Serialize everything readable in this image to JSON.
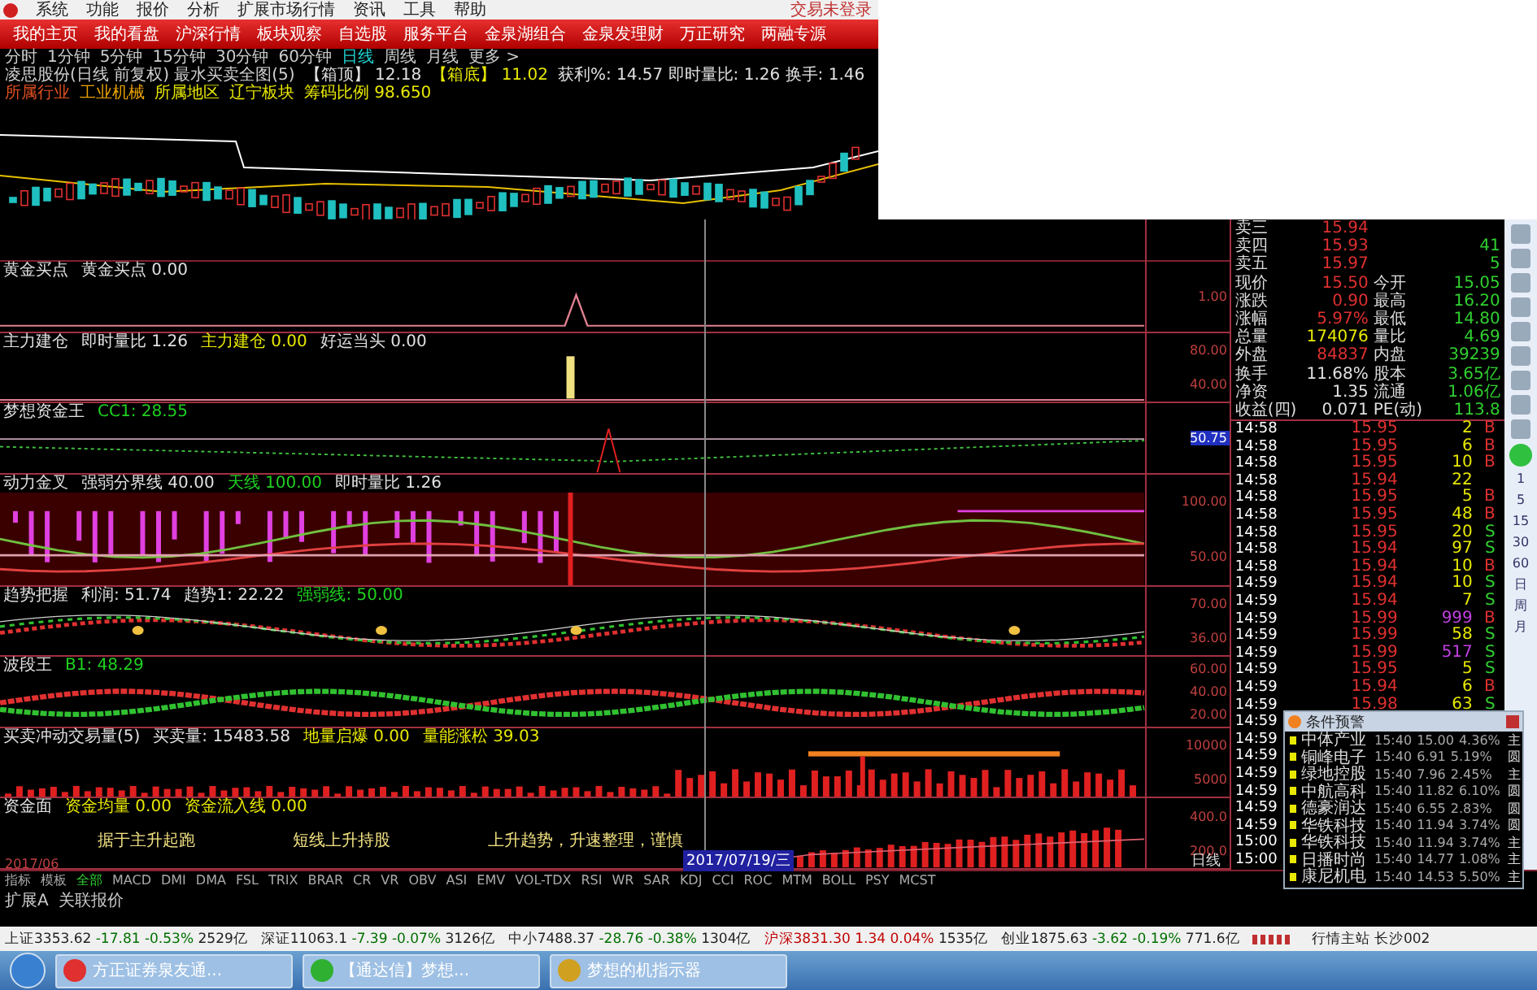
{
  "menu_bar": {
    "items": [
      "系统",
      "功能",
      "报价",
      "分析",
      "扩展市场行情",
      "资讯",
      "工具",
      "帮助"
    ],
    "login_status": "交易未登录"
  },
  "nav_bar": {
    "items": [
      "我的主页",
      "我的看盘",
      "沪深行情",
      "板块观察",
      "自选股",
      "服务平台",
      "金泉湖组合",
      "金泉发理财",
      "万正研究",
      "两融专源"
    ]
  },
  "periods": [
    {
      "label": "分时",
      "selected": false
    },
    {
      "label": "1分钟",
      "selected": false
    },
    {
      "label": "5分钟",
      "selected": false
    },
    {
      "label": "15分钟",
      "selected": false
    },
    {
      "label": "30分钟",
      "selected": false
    },
    {
      "label": "60分钟",
      "selected": false
    },
    {
      "label": "日线",
      "selected": true
    },
    {
      "label": "周线",
      "selected": false
    },
    {
      "label": "月线",
      "selected": false
    },
    {
      "label": "更多 >",
      "selected": false
    }
  ],
  "info_line": [
    {
      "text": "凌思股份(日线 前复权) 最水买卖全图(5)",
      "color": "#d0d0d0"
    },
    {
      "text": "【箱顶】 12.18",
      "color": "#e0e0e0"
    },
    {
      "text": "【箱底】 11.02",
      "color": "#e8e800"
    },
    {
      "text": "获利%: 14.57  即时量比: 1.26  换手: 1.46",
      "color": "#e0e0e0"
    }
  ],
  "info_line_2": [
    {
      "text": "所属行业",
      "color": "#e05020"
    },
    {
      "text": "工业机械",
      "color": "#e8a000"
    },
    {
      "text": "所属地区",
      "color": "#e8e800"
    },
    {
      "text": "辽宁板块",
      "color": "#e8e800"
    },
    {
      "text": "筹码比例 98.650",
      "color": "#e8e800"
    }
  ],
  "panels": [
    {
      "kind": "spike",
      "title": [
        {
          "text": "黄金买点",
          "color": "#e0e0e0"
        },
        {
          "text": "黄金买点 0.00",
          "color": "#e0e0e0"
        }
      ],
      "axis": [
        {
          "text": "1.00",
          "highlighted": false
        }
      ]
    },
    {
      "kind": "bar-spike",
      "title": [
        {
          "text": "主力建仓",
          "color": "#e0e0e0"
        },
        {
          "text": "即时量比 1.26",
          "color": "#e0e0e0"
        },
        {
          "text": "主力建仓 0.00",
          "color": "#e8e800"
        },
        {
          "text": "好运当头 0.00",
          "color": "#e0e0e0"
        }
      ],
      "axis": [
        {
          "text": "80.00",
          "highlighted": false
        },
        {
          "text": "40.00",
          "highlighted": false
        }
      ]
    },
    {
      "kind": "curve",
      "title": [
        {
          "text": "梦想资金王",
          "color": "#e0e0e0"
        },
        {
          "text": "CC1: 28.55",
          "color": "#20d020"
        }
      ],
      "axis": [
        {
          "text": "50.75",
          "highlighted": true
        }
      ]
    },
    {
      "kind": "histogram",
      "title": [
        {
          "text": "动力金叉",
          "color": "#e0e0e0"
        },
        {
          "text": "强弱分界线 40.00",
          "color": "#e0e0e0"
        },
        {
          "text": "天线 100.00",
          "color": "#20d020"
        },
        {
          "text": "即时量比 1.26",
          "color": "#e0e0e0"
        }
      ],
      "axis": [
        {
          "text": "100.00",
          "highlighted": false
        },
        {
          "text": "50.00",
          "highlighted": false
        }
      ]
    },
    {
      "kind": "ribbon",
      "title": [
        {
          "text": "趋势把握",
          "color": "#e0e0e0"
        },
        {
          "text": "利润: 51.74",
          "color": "#e0e0e0"
        },
        {
          "text": "趋势1: 22.22",
          "color": "#e0e0e0"
        },
        {
          "text": "强弱线: 50.00",
          "color": "#20d020"
        }
      ],
      "axis": [
        {
          "text": "70.00",
          "highlighted": false
        },
        {
          "text": "36.00",
          "highlighted": false
        }
      ]
    },
    {
      "kind": "wave",
      "title": [
        {
          "text": "波段王",
          "color": "#e0e0e0"
        },
        {
          "text": "B1: 48.29",
          "color": "#20d020"
        }
      ],
      "axis": [
        {
          "text": "60.00",
          "highlighted": false
        },
        {
          "text": "40.00",
          "highlighted": false
        },
        {
          "text": "20.00",
          "highlighted": false
        }
      ]
    },
    {
      "kind": "volume",
      "title": [
        {
          "text": "买卖冲动交易量(5)",
          "color": "#e0e0e0"
        },
        {
          "text": "买卖量: 15483.58",
          "color": "#e0e0e0"
        },
        {
          "text": "地量启爆 0.00",
          "color": "#e8e800"
        },
        {
          "text": "量能涨松 39.03",
          "color": "#e8e800"
        }
      ],
      "axis": [
        {
          "text": "10000",
          "highlighted": false
        },
        {
          "text": "5000",
          "highlighted": false
        }
      ]
    },
    {
      "kind": "area",
      "title": [
        {
          "text": "资金面",
          "color": "#e0e0e0"
        },
        {
          "text": "资金均量 0.00",
          "color": "#e8e800"
        },
        {
          "text": "资金流入线 0.00",
          "color": "#e8e800"
        }
      ],
      "axis": [
        {
          "text": "400.0",
          "highlighted": false
        },
        {
          "text": "200.0",
          "highlighted": false
        }
      ],
      "notes": [
        "据于主升起跑",
        "短线上升持股",
        "上升趋势，升速整理，谨慎"
      ]
    }
  ],
  "date_axis": {
    "start": "2017/06",
    "cursor": "2017/07/19/三",
    "period": "日线"
  },
  "quote": [
    {
      "label": "卖三",
      "value": "15.94",
      "color": "#e03030"
    },
    {
      "label": "卖四",
      "value": "15.93",
      "color": "#e03030",
      "value_2": "41"
    },
    {
      "label": "卖五",
      "value": "15.97",
      "color": "#e03030",
      "value_2": "5"
    },
    {
      "label": "现价",
      "value": "15.50",
      "color": "#e03030",
      "label_2": "今开",
      "value_2": "15.05"
    },
    {
      "label": "涨跌",
      "value": "0.90",
      "color": "#e03030",
      "label_2": "最高",
      "value_2": "16.20"
    },
    {
      "label": "涨幅",
      "value": "5.97%",
      "color": "#e03030",
      "label_2": "最低",
      "value_2": "14.80"
    },
    {
      "label": "总量",
      "value": "174076",
      "color": "#e8e800",
      "label_2": "量比",
      "value_2": "4.69"
    },
    {
      "label": "外盘",
      "value": "84837",
      "color": "#e03030",
      "label_2": "内盘",
      "value_2": "39239"
    },
    {
      "label": "换手",
      "value": "11.68%",
      "color": "#e0e0e0",
      "label_2": "股本",
      "value_2": "3.65亿"
    },
    {
      "label": "净资",
      "value": "1.35",
      "color": "#e0e0e0",
      "label_2": "流通",
      "value_2": "1.06亿"
    },
    {
      "label": "收益(四)",
      "value": "0.071",
      "color": "#e0e0e0",
      "label_2": "PE(动)",
      "value_2": "113.8"
    }
  ],
  "trades": [
    {
      "time": "14:58",
      "price": "15.95",
      "volume": "2",
      "large": false,
      "kind": "buy",
      "side": "B"
    },
    {
      "time": "14:58",
      "price": "15.95",
      "volume": "6",
      "large": false,
      "kind": "buy",
      "side": "B"
    },
    {
      "time": "14:58",
      "price": "15.95",
      "volume": "10",
      "large": false,
      "kind": "buy",
      "side": "B"
    },
    {
      "time": "14:58",
      "price": "15.94",
      "volume": "22",
      "large": false
    },
    {
      "time": "14:58",
      "price": "15.95",
      "volume": "5",
      "large": false,
      "kind": "buy",
      "side": "B"
    },
    {
      "time": "14:58",
      "price": "15.95",
      "volume": "48",
      "large": false,
      "kind": "buy",
      "side": "B"
    },
    {
      "time": "14:58",
      "price": "15.95",
      "volume": "20",
      "large": false,
      "kind": "sell",
      "side": "S"
    },
    {
      "time": "14:58",
      "price": "15.94",
      "volume": "97",
      "large": false,
      "kind": "sell",
      "side": "S"
    },
    {
      "time": "14:58",
      "price": "15.94",
      "volume": "10",
      "large": false,
      "kind": "buy",
      "side": "B"
    },
    {
      "time": "14:59",
      "price": "15.94",
      "volume": "10",
      "large": false,
      "kind": "sell",
      "side": "S"
    },
    {
      "time": "14:59",
      "price": "15.94",
      "volume": "7",
      "large": false,
      "kind": "sell",
      "side": "S"
    },
    {
      "time": "14:59",
      "price": "15.99",
      "volume": "999",
      "large": true,
      "kind": "buy",
      "side": "B"
    },
    {
      "time": "14:59",
      "price": "15.99",
      "volume": "58",
      "large": false,
      "kind": "sell",
      "side": "S"
    },
    {
      "time": "14:59",
      "price": "15.99",
      "volume": "517",
      "large": true,
      "kind": "sell",
      "side": "S"
    },
    {
      "time": "14:59",
      "price": "15.95",
      "volume": "5",
      "large": false,
      "kind": "sell",
      "side": "S"
    },
    {
      "time": "14:59",
      "price": "15.94",
      "volume": "6",
      "large": false,
      "kind": "buy",
      "side": "B"
    },
    {
      "time": "14:59",
      "price": "15.98",
      "volume": "63",
      "large": false,
      "kind": "sell",
      "side": "S"
    },
    {
      "time": "14:59"
    },
    {
      "time": "14:59"
    },
    {
      "time": "14:59"
    },
    {
      "time": "14:59"
    },
    {
      "time": "14:59"
    },
    {
      "time": "14:59"
    },
    {
      "time": "14:59"
    },
    {
      "time": "15:00"
    },
    {
      "time": "15:00"
    }
  ],
  "side_periods": [
    "1",
    "5",
    "15",
    "30",
    "60",
    "日",
    "周",
    "月"
  ],
  "alert_window": {
    "title": "条件预警",
    "rows": [
      {
        "name": "中体产业",
        "time": "15:40",
        "price": "15.00",
        "change": "4.36%",
        "tag": "主"
      },
      {
        "name": "铜峰电子",
        "time": "15:40",
        "price": "6.91",
        "change": "5.19%",
        "tag": "圆"
      },
      {
        "name": "绿地控股",
        "time": "15:40",
        "price": "7.96",
        "change": "2.45%",
        "tag": "主"
      },
      {
        "name": "中航高科",
        "time": "15:40",
        "price": "11.82",
        "change": "6.10%",
        "tag": "圆"
      },
      {
        "name": "德豪润达",
        "time": "15:40",
        "price": "6.55",
        "change": "2.83%",
        "tag": "圆"
      },
      {
        "name": "华铁科技",
        "time": "15:40",
        "price": "11.94",
        "change": "3.74%",
        "tag": "圆"
      },
      {
        "name": "华铁科技",
        "time": "15:40",
        "price": "11.94",
        "change": "3.74%",
        "tag": "主"
      },
      {
        "name": "日播时尚",
        "time": "15:40",
        "price": "14.77",
        "change": "1.08%",
        "tag": "主"
      },
      {
        "name": "康尼机电",
        "time": "15:40",
        "price": "14.53",
        "change": "5.50%",
        "tag": "主"
      }
    ]
  },
  "indicator_tabs": [
    {
      "label": "指标",
      "selected": false
    },
    {
      "label": "模板",
      "selected": false
    },
    {
      "label": "全部",
      "selected": true
    },
    {
      "label": "MACD",
      "selected": false
    },
    {
      "label": "DMI",
      "selected": false
    },
    {
      "label": "DMA",
      "selected": false
    },
    {
      "label": "FSL",
      "selected": false
    },
    {
      "label": "TRIX",
      "selected": false
    },
    {
      "label": "BRAR",
      "selected": false
    },
    {
      "label": "CR",
      "selected": false
    },
    {
      "label": "VR",
      "selected": false
    },
    {
      "label": "OBV",
      "selected": false
    },
    {
      "label": "ASI",
      "selected": false
    },
    {
      "label": "EMV",
      "selected": false
    },
    {
      "label": "VOL-TDX",
      "selected": false
    },
    {
      "label": "RSI",
      "selected": false
    },
    {
      "label": "WR",
      "selected": false
    },
    {
      "label": "SAR",
      "selected": false
    },
    {
      "label": "KDJ",
      "selected": false
    },
    {
      "label": "CCI",
      "selected": false
    },
    {
      "label": "ROC",
      "selected": false
    },
    {
      "label": "MTM",
      "selected": false
    },
    {
      "label": "BOLL",
      "selected": false
    },
    {
      "label": "PSY",
      "selected": false
    },
    {
      "label": "MCST",
      "selected": false
    }
  ],
  "extension_tabs": [
    "扩展A",
    "关联报价"
  ],
  "status_bar": {
    "indices": [
      {
        "name": "上证",
        "value": "3353.62",
        "change": "-17.81",
        "percent": "-0.53%",
        "amount": "2529亿",
        "kind": "down"
      },
      {
        "name": "深证",
        "value": "11063.1",
        "change": "-7.39",
        "percent": "-0.07%",
        "amount": "3126亿",
        "kind": "down"
      },
      {
        "name": "中小",
        "value": "7488.37",
        "change": "-28.76",
        "percent": "-0.38%",
        "amount": "1304亿",
        "kind": "down"
      },
      {
        "name": "沪深",
        "value": "3831.30",
        "change": "1.34",
        "percent": "0.04%",
        "amount": "1535亿",
        "kind": "up"
      },
      {
        "name": "创业",
        "value": "1875.63",
        "change": "-3.62",
        "percent": "-0.19%",
        "amount": "771.6亿",
        "kind": "down"
      }
    ],
    "server": "行情主站 长沙002"
  },
  "taskbar": {
    "items": [
      "方正证券泉友通...",
      "【通达信】梦想...",
      "梦想的机指示器"
    ]
  }
}
